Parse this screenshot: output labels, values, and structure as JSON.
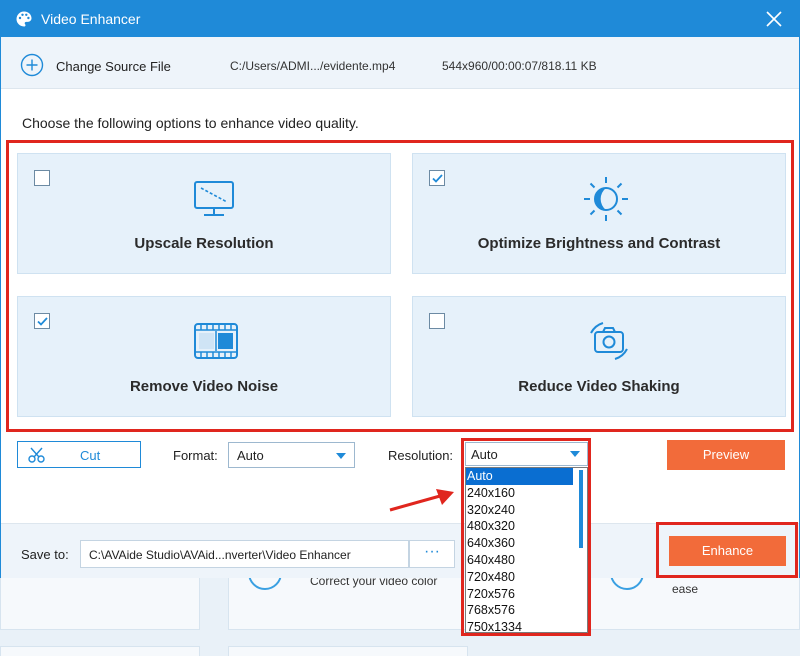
{
  "window": {
    "title": "Video Enhancer"
  },
  "source": {
    "change_label": "Change Source File",
    "path": "C:/Users/ADMI.../evidente.mp4",
    "info": "544x960/00:00:07/818.11 KB"
  },
  "instructions": "Choose the following options to enhance video quality.",
  "options": [
    {
      "label": "Upscale Resolution",
      "checked": false,
      "icon": "monitor-icon"
    },
    {
      "label": "Optimize Brightness and Contrast",
      "checked": true,
      "icon": "brightness-icon"
    },
    {
      "label": "Remove Video Noise",
      "checked": true,
      "icon": "film-icon"
    },
    {
      "label": "Reduce Video Shaking",
      "checked": false,
      "icon": "camera-icon"
    }
  ],
  "controls": {
    "cut_label": "Cut",
    "format_label": "Format:",
    "format_value": "Auto",
    "resolution_label": "Resolution:",
    "resolution_value": "Auto",
    "preview_label": "Preview"
  },
  "resolution_options": [
    "Auto",
    "240x160",
    "320x240",
    "480x320",
    "640x360",
    "640x480",
    "720x480",
    "720x576",
    "768x576",
    "750x1334"
  ],
  "save": {
    "label": "Save to:",
    "path": "C:\\AVAide Studio\\AVAid...nverter\\Video Enhancer",
    "more_label": "···",
    "enhance_label": "Enhance"
  },
  "background_app": {
    "text_1": "Correct your video color",
    "text_2": "ease"
  },
  "colors": {
    "accent": "#1f8ad8",
    "action": "#f26b3a",
    "highlight_frame": "#e0261e",
    "card_bg": "#e6f1fa"
  }
}
